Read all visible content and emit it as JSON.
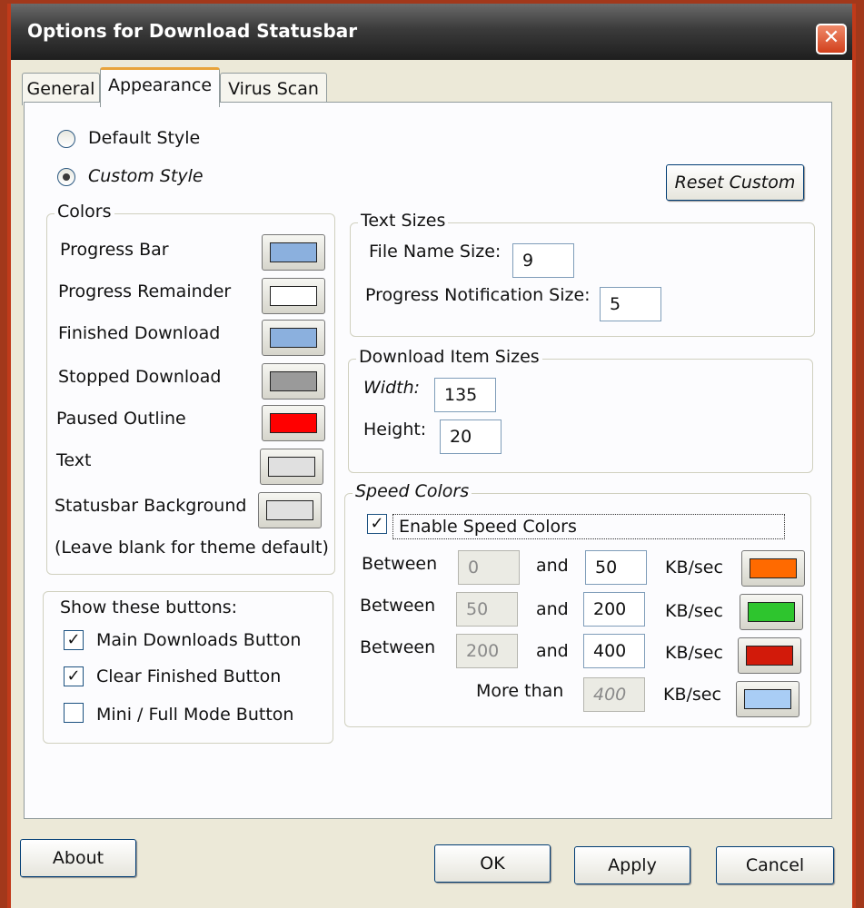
{
  "window": {
    "title": "Options for Download Statusbar"
  },
  "tabs": [
    "General",
    "Appearance",
    "Virus Scan"
  ],
  "style": {
    "default_label": "Default Style",
    "custom_label": "Custom Style",
    "selected": "Custom Style"
  },
  "reset_custom": "Reset Custom",
  "colors": {
    "title": "Colors",
    "items": [
      {
        "label": "Progress Bar",
        "color": "#8bb0de"
      },
      {
        "label": "Progress Remainder",
        "color": "#ffffff"
      },
      {
        "label": "Finished Download",
        "color": "#8bb0de"
      },
      {
        "label": "Stopped Download",
        "color": "#9a9a9a"
      },
      {
        "label": "Paused Outline",
        "color": "#ff0000"
      },
      {
        "label": "Text",
        "color": "#e0e0e0"
      },
      {
        "label": "Statusbar Background",
        "color": "#e0e0e0"
      }
    ],
    "note": "(Leave blank for theme default)"
  },
  "text_sizes": {
    "title": "Text Sizes",
    "file_name_label": "File Name Size:",
    "file_name_value": "9",
    "progress_label": "Progress Notification Size:",
    "progress_value": "5"
  },
  "item_sizes": {
    "title": "Download Item Sizes",
    "width_label": "Width:",
    "width_value": "135",
    "height_label": "Height:",
    "height_value": "20"
  },
  "speed": {
    "title": "Speed Colors",
    "enable_label": "Enable Speed Colors",
    "enabled": true,
    "between_label": "Between",
    "and_label": "and",
    "unit": "KB/sec",
    "rows": [
      {
        "from": "0",
        "to": "50",
        "color": "#ff6a00"
      },
      {
        "from": "50",
        "to": "200",
        "color": "#2ec52e"
      },
      {
        "from": "200",
        "to": "400",
        "color": "#d21a0a"
      }
    ],
    "more_label": "More than",
    "more_value": "400",
    "more_color": "#a9cdf5"
  },
  "buttons_group": {
    "title": "Show these buttons:",
    "items": [
      {
        "label": "Main Downloads Button",
        "checked": true
      },
      {
        "label": "Clear Finished Button",
        "checked": true
      },
      {
        "label": "Mini / Full Mode Button",
        "checked": false
      }
    ]
  },
  "footer": {
    "about": "About",
    "ok": "OK",
    "apply": "Apply",
    "cancel": "Cancel"
  },
  "icons": {
    "close": "close-icon",
    "check": "check-icon"
  }
}
